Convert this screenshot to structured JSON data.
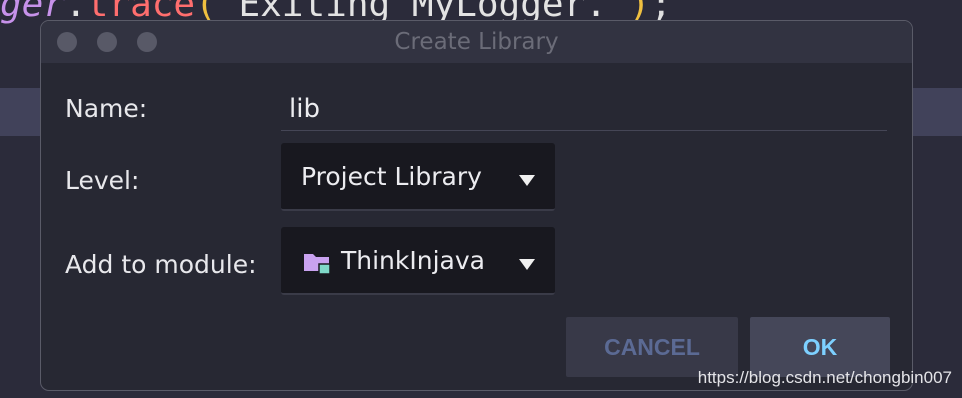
{
  "editor": {
    "code_fn": "ger",
    "code_dot": ".",
    "code_method": "trace",
    "code_paren_open": "(",
    "code_string": "\"Exiting MyLogger.\"",
    "code_paren_close": ")",
    "code_semi": ";"
  },
  "dialog": {
    "title": "Create Library",
    "name_label": "Name:",
    "name_value": "lib",
    "level_label": "Level:",
    "level_value": "Project Library",
    "module_label": "Add to module:",
    "module_value": "ThinkInjava",
    "cancel_label": "CANCEL",
    "ok_label": "OK"
  },
  "icons": {
    "traffic_lights": "window-control-icon",
    "dropdown": "caret-down-icon",
    "module": "folder-module-icon"
  },
  "colors": {
    "background": "#2b2b3a",
    "dialog": "#272833",
    "ok_text": "#7dd0ff",
    "cancel_text": "#5b6a94",
    "folder": "#c9a2f0",
    "folder_badge": "#7fd8c8"
  },
  "watermark": "https://blog.csdn.net/chongbin007"
}
